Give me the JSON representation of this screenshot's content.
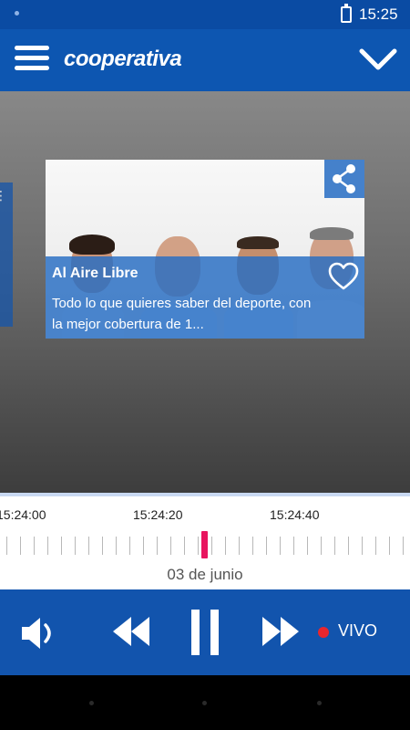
{
  "status_bar": {
    "time": "15:25"
  },
  "app_bar": {
    "logo_text": "cooperativa"
  },
  "program_card": {
    "title": "Al Aire Libre",
    "description": "Todo lo que quieres saber del deporte, con la mejor cobertura de 1..."
  },
  "timeline": {
    "labels": [
      "15:24:00",
      "15:24:20",
      "15:24:40"
    ],
    "date": "03 de junio"
  },
  "player": {
    "live_label": "VIVO"
  },
  "icons": {
    "menu": "hamburger-menu-icon",
    "collapse": "chevron-down-icon",
    "share": "share-icon",
    "favorite": "heart-outline-icon",
    "volume": "speaker-icon",
    "rewind": "rewind-icon",
    "pause": "pause-icon",
    "forward": "fast-forward-icon",
    "live": "live-dot-icon"
  },
  "colors": {
    "app_bar": "#0d56b1",
    "player_bar": "#1254ad",
    "card_overlay": "#266cc3",
    "marker": "#e8155f",
    "live_dot": "#e8262d"
  }
}
